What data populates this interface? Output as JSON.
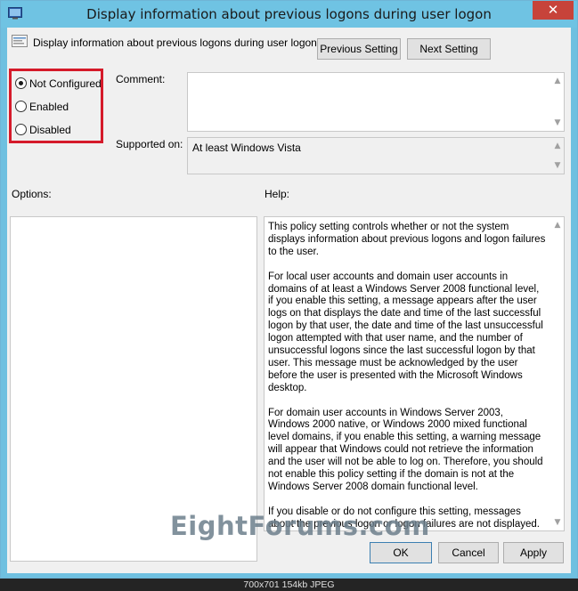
{
  "window": {
    "title": "Display information about previous logons during user logon",
    "close_glyph": "✕"
  },
  "header": {
    "setting_name": "Display information about previous logons during user logon",
    "previous_button": "Previous Setting",
    "next_button": "Next Setting"
  },
  "state": {
    "options": [
      {
        "label": "Not Configured",
        "selected": true
      },
      {
        "label": "Enabled",
        "selected": false
      },
      {
        "label": "Disabled",
        "selected": false
      }
    ]
  },
  "comment": {
    "label": "Comment:",
    "value": ""
  },
  "supported_on": {
    "label": "Supported on:",
    "value": "At least Windows Vista"
  },
  "options_pane": {
    "label": "Options:"
  },
  "help": {
    "label": "Help:",
    "paragraphs": [
      "This policy setting controls whether or not the system displays information about previous logons and logon failures to the user.",
      "For local user accounts and domain user accounts in domains of at least a Windows Server 2008 functional level, if you enable this setting, a message appears after the user logs on that displays the date and time of the last successful logon by that user, the date and time of the last unsuccessful logon attempted with that user name, and the number of unsuccessful logons since the last successful logon by that user. This message must be acknowledged by the user before the user is presented with the Microsoft Windows desktop.",
      "For domain user accounts in Windows Server 2003, Windows 2000 native, or Windows 2000 mixed functional level domains, if you enable this setting, a warning message will appear that Windows could not retrieve the information and the user will not be able to log on. Therefore, you should not enable this policy setting if the domain is not at the Windows Server 2008 domain functional level.",
      "If you disable or do not configure this setting, messages about the previous logon or logon failures are not displayed."
    ]
  },
  "footer": {
    "ok": "OK",
    "cancel": "Cancel",
    "apply": "Apply"
  },
  "watermark": "EightForums.com",
  "image_info": "700x701  154kb  JPEG"
}
